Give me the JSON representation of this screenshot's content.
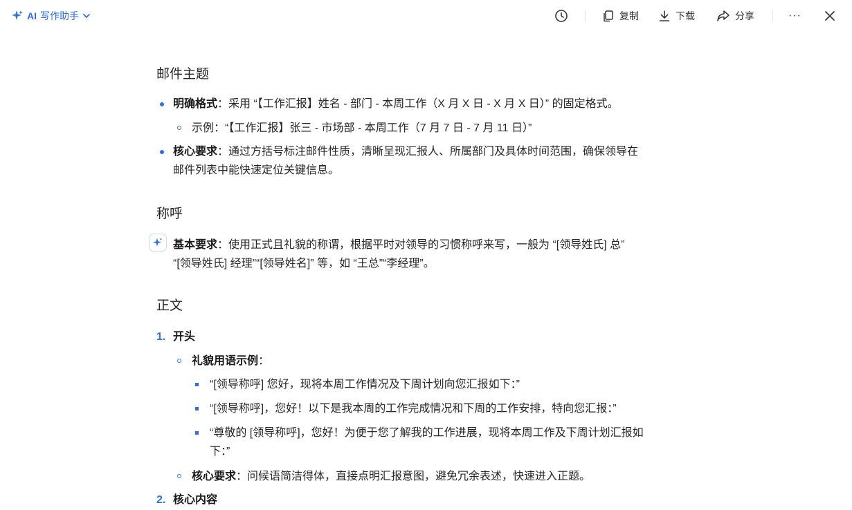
{
  "header": {
    "brand_ai": "AI",
    "brand_name": "写作助手",
    "copy_label": "复制",
    "download_label": "下载",
    "share_label": "分享",
    "more_label": "···"
  },
  "doc": {
    "s1_title": "邮件主题",
    "s1_b1_bold": "明确格式",
    "s1_b1_text": "：采用 “【工作汇报】姓名 - 部门 - 本周工作（X 月 X 日 - X 月 X 日）” 的固定格式。",
    "s1_b1_sub": "示例：“【工作汇报】张三 - 市场部 - 本周工作（7 月 7 日 - 7 月 11 日）”",
    "s1_b2_bold": "核心要求",
    "s1_b2_line1": "：通过方括号标注邮件性质，清晰呈现汇报人、所属部门及具体时间范围，确保领导在",
    "s1_b2_line2": "邮件列表中能快速定位关键信息。",
    "s2_title": "称呼",
    "s2_b1_bold": "基本要求",
    "s2_b1_line1": "：使用正式且礼貌的称谓，根据平时对领导的习惯称呼来写，一般为 “[领导姓氏] 总”",
    "s2_b1_line2": "“[领导姓氏] 经理”“[领导姓名]” 等，如 “王总”“李经理”。",
    "s3_title": "正文",
    "s3_n1": "1.",
    "s3_n1_title": "开头",
    "s3_sub1_bold": "礼貌用语示例",
    "s3_sub1_colon": "：",
    "s3_ex1": "“[领导称呼] 您好，现将本周工作情况及下周计划向您汇报如下：”",
    "s3_ex2": "“[领导称呼]，您好！以下是我本周的工作完成情况和下周的工作安排，特向您汇报：”",
    "s3_ex3_line1": "“尊敬的 [领导称呼]，您好！为便于您了解我的工作进展，现将本周工作及下周计划汇报如",
    "s3_ex3_line2": "下：”",
    "s3_sub2_bold": "核心要求",
    "s3_sub2_text": "：问候语简洁得体，直接点明汇报意图，避免冗余表述，快速进入正题。",
    "s3_n2": "2.",
    "s3_n2_title": "核心内容"
  },
  "colors": {
    "accent": "#2f6fe6",
    "text": "#262626"
  }
}
